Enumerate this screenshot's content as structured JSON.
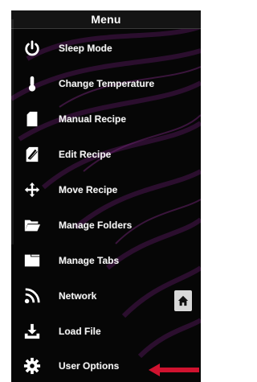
{
  "menu": {
    "title": "Menu",
    "items": [
      {
        "id": "sleep",
        "label": "Sleep Mode",
        "icon": "power-icon"
      },
      {
        "id": "temperature",
        "label": "Change Temperature",
        "icon": "thermometer-icon"
      },
      {
        "id": "manual-recipe",
        "label": "Manual Recipe",
        "icon": "document-icon"
      },
      {
        "id": "edit-recipe",
        "label": "Edit Recipe",
        "icon": "edit-document-icon"
      },
      {
        "id": "move-recipe",
        "label": "Move Recipe",
        "icon": "move-arrows-icon"
      },
      {
        "id": "manage-folders",
        "label": "Manage Folders",
        "icon": "folder-icon"
      },
      {
        "id": "manage-tabs",
        "label": "Manage Tabs",
        "icon": "tabs-icon"
      },
      {
        "id": "network",
        "label": "Network",
        "icon": "wifi-rss-icon"
      },
      {
        "id": "load-file",
        "label": "Load File",
        "icon": "download-icon"
      },
      {
        "id": "user-options",
        "label": "User Options",
        "icon": "gear-icon"
      }
    ]
  },
  "home": {
    "icon": "home-icon"
  },
  "annotation": {
    "icon": "red-arrow-icon",
    "color": "#d0122f"
  },
  "colors": {
    "panel": "#060606",
    "text": "#f2f2f2",
    "swirl": "#5a1a5e",
    "home_button": "#d9d9d9"
  }
}
